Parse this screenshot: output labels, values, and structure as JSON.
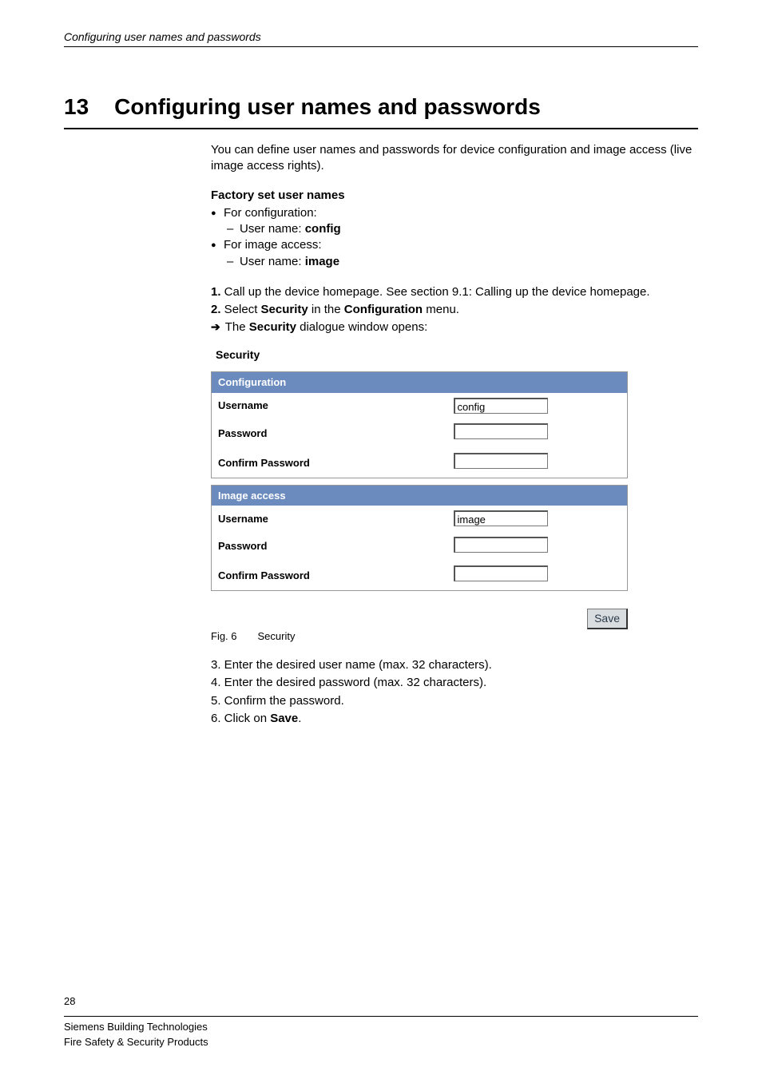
{
  "running_header": "Configuring user names and passwords",
  "chapter": {
    "number": "13",
    "title": "Configuring user names and passwords"
  },
  "intro": "You can define user names and passwords for device configuration and image access (live image access rights).",
  "factory": {
    "title": "Factory set user names",
    "config_label": "For configuration:",
    "config_user_prefix": "User name: ",
    "config_user": "config",
    "image_label": "For image access:",
    "image_user_prefix": "User name: ",
    "image_user": "image"
  },
  "steps_a": {
    "s1_num": "1.",
    "s1_text": " Call up the device homepage. See section 9.1: Calling up the device homepage.",
    "s2_num": "2.",
    "s2_pre": " Select ",
    "s2_bold1": "Security",
    "s2_mid": " in the ",
    "s2_bold2": "Configuration",
    "s2_post": " menu.",
    "arrow_pre": "The ",
    "arrow_bold": "Security",
    "arrow_post": " dialogue window opens:"
  },
  "screenshot": {
    "title": "Security",
    "section_config": "Configuration",
    "section_image": "Image access",
    "row_user": "Username",
    "row_pass": "Password",
    "row_confirm": "Confirm Password",
    "val_config_user": "config",
    "val_image_user": "image",
    "save": "Save"
  },
  "figure": {
    "label": "Fig. 6",
    "caption": "Security"
  },
  "steps_b": {
    "s3_num": "3.",
    "s3_text": " Enter the desired user name (max. 32 characters).",
    "s4_num": "4.",
    "s4_text": " Enter the desired password (max. 32 characters).",
    "s5_num": "5.",
    "s5_text": " Confirm the password.",
    "s6_num": "6.",
    "s6_pre": " Click on ",
    "s6_bold": "Save",
    "s6_post": "."
  },
  "page_number": "28",
  "footer": {
    "line1": "Siemens Building Technologies",
    "line2": "Fire Safety & Security Products"
  }
}
